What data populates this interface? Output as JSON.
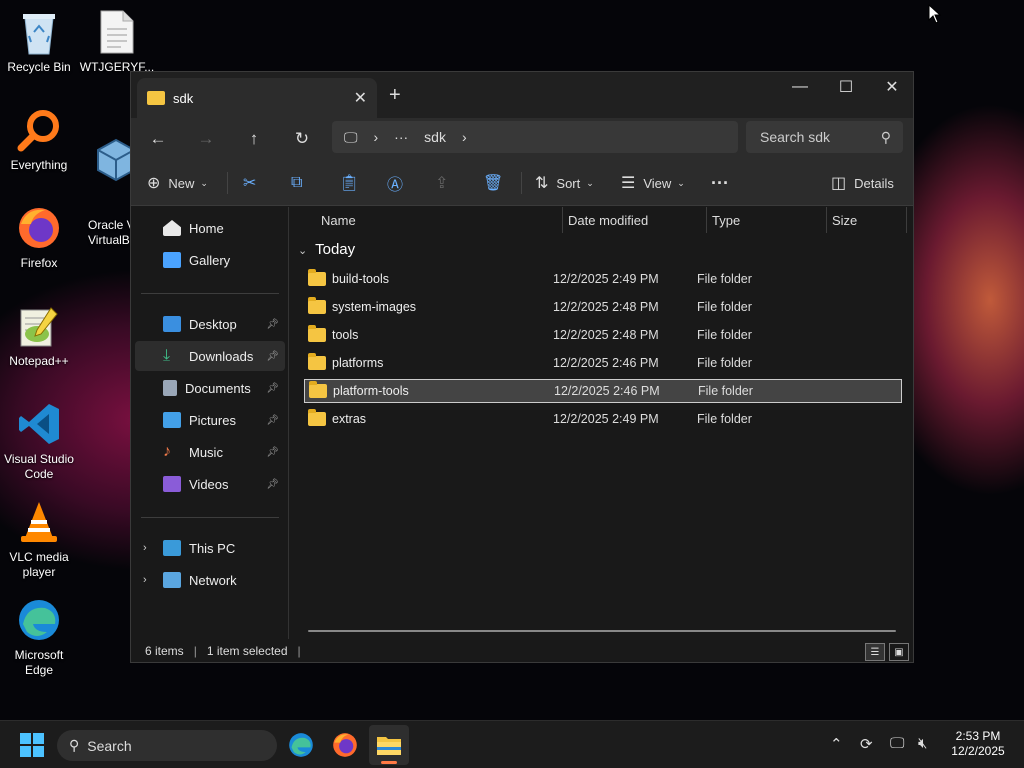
{
  "desktop": {
    "icons": [
      {
        "label": "Recycle Bin"
      },
      {
        "label": "WTJGERYF..."
      },
      {
        "label": "Everything"
      },
      {
        "label": "Oracle V\nVirtualB"
      },
      {
        "label": "Firefox"
      },
      {
        "label": "Notepad++"
      },
      {
        "label": "Visual Studio Code"
      },
      {
        "label": "VLC media player"
      },
      {
        "label": "Microsoft Edge"
      }
    ]
  },
  "window": {
    "tab_title": "sdk",
    "address": {
      "more": "···",
      "segment": "sdk"
    },
    "search_placeholder": "Search sdk",
    "toolbar": {
      "new": "New",
      "sort": "Sort",
      "view": "View",
      "more": "···",
      "details": "Details"
    },
    "nav": {
      "home": "Home",
      "gallery": "Gallery",
      "desktop": "Desktop",
      "downloads": "Downloads",
      "documents": "Documents",
      "pictures": "Pictures",
      "music": "Music",
      "videos": "Videos",
      "this_pc": "This PC",
      "network": "Network"
    },
    "columns": {
      "name": "Name",
      "date": "Date modified",
      "type": "Type",
      "size": "Size"
    },
    "group": "Today",
    "files": [
      {
        "name": "build-tools",
        "date": "12/2/2025 2:49 PM",
        "type": "File folder"
      },
      {
        "name": "system-images",
        "date": "12/2/2025 2:48 PM",
        "type": "File folder"
      },
      {
        "name": "tools",
        "date": "12/2/2025 2:48 PM",
        "type": "File folder"
      },
      {
        "name": "platforms",
        "date": "12/2/2025 2:46 PM",
        "type": "File folder"
      },
      {
        "name": "platform-tools",
        "date": "12/2/2025 2:46 PM",
        "type": "File folder"
      },
      {
        "name": "extras",
        "date": "12/2/2025 2:49 PM",
        "type": "File folder"
      }
    ],
    "selected_index": 4,
    "status": {
      "items": "6 items",
      "selected": "1 item selected"
    }
  },
  "taskbar": {
    "search_label": "Search",
    "clock_time": "2:53 PM",
    "clock_date": "12/2/2025"
  },
  "colors": {
    "accent": "#6ab0ff",
    "folder": "#f5c542",
    "selected_row": "#444444"
  }
}
